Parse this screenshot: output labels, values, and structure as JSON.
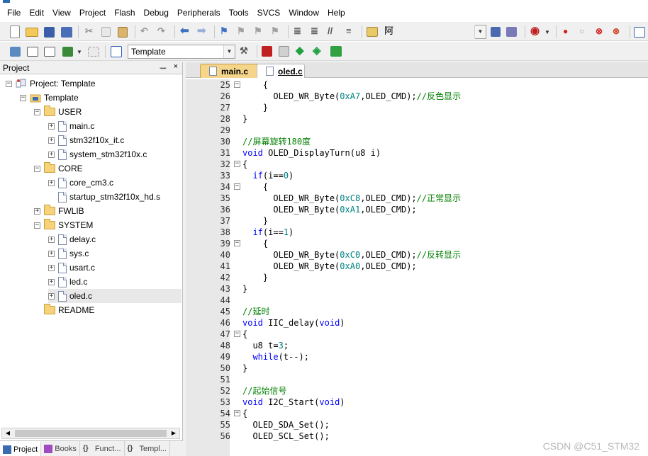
{
  "menu": [
    "File",
    "Edit",
    "View",
    "Project",
    "Flash",
    "Debug",
    "Peripherals",
    "Tools",
    "SVCS",
    "Window",
    "Help"
  ],
  "toolbar1": {
    "combo_value": "",
    "text_glyph": "阿"
  },
  "toolbar2": {
    "target_combo_value": "Template"
  },
  "project_pane": {
    "title": "Project",
    "pin_glyph": "ᅲ",
    "close_glyph": "×",
    "tree": [
      {
        "label": "Project: Template",
        "level": 0,
        "kind": "project",
        "expanded": true
      },
      {
        "label": "Template",
        "level": 1,
        "kind": "target",
        "expanded": true
      },
      {
        "label": "USER",
        "level": 2,
        "kind": "folder",
        "expanded": true
      },
      {
        "label": "main.c",
        "level": 3,
        "kind": "file"
      },
      {
        "label": "stm32f10x_it.c",
        "level": 3,
        "kind": "file"
      },
      {
        "label": "system_stm32f10x.c",
        "level": 3,
        "kind": "file"
      },
      {
        "label": "CORE",
        "level": 2,
        "kind": "folder",
        "expanded": true
      },
      {
        "label": "core_cm3.c",
        "level": 3,
        "kind": "file"
      },
      {
        "label": "startup_stm32f10x_hd.s",
        "level": 3,
        "kind": "file-noexp"
      },
      {
        "label": "FWLIB",
        "level": 2,
        "kind": "folder",
        "expanded": false
      },
      {
        "label": "SYSTEM",
        "level": 2,
        "kind": "folder",
        "expanded": true
      },
      {
        "label": "delay.c",
        "level": 3,
        "kind": "file"
      },
      {
        "label": "sys.c",
        "level": 3,
        "kind": "file"
      },
      {
        "label": "usart.c",
        "level": 3,
        "kind": "file"
      },
      {
        "label": "led.c",
        "level": 3,
        "kind": "file"
      },
      {
        "label": "oled.c",
        "level": 3,
        "kind": "file",
        "selected": true
      },
      {
        "label": "README",
        "level": 2,
        "kind": "folder-noexp"
      }
    ],
    "bottom_tabs": [
      "Project",
      "Books",
      "Funct...",
      "Templ..."
    ]
  },
  "editor": {
    "tabs": [
      "main.c",
      "oled.c"
    ],
    "active_tab": "oled.c",
    "lines": [
      {
        "n": "25",
        "fold": "-",
        "html": "    {"
      },
      {
        "n": "26",
        "fold": "",
        "html": "      OLED_WR_Byte(<span class=\"num\">0xA7</span>,OLED_CMD);<span class=\"cm\">//反色显示</span>"
      },
      {
        "n": "27",
        "fold": "",
        "html": "    }"
      },
      {
        "n": "28",
        "fold": "",
        "html": "}"
      },
      {
        "n": "29",
        "fold": "",
        "html": ""
      },
      {
        "n": "30",
        "fold": "",
        "html": "<span class=\"cm\">//屏幕旋转180度</span>"
      },
      {
        "n": "31",
        "fold": "",
        "html": "<span class=\"kw\">void</span> OLED_DisplayTurn(u8 i)"
      },
      {
        "n": "32",
        "fold": "-",
        "html": "{"
      },
      {
        "n": "33",
        "fold": "",
        "html": "  <span class=\"kw\">if</span>(i==<span class=\"num\">0</span>)"
      },
      {
        "n": "34",
        "fold": "-",
        "html": "    {"
      },
      {
        "n": "35",
        "fold": "",
        "html": "      OLED_WR_Byte(<span class=\"num\">0xC8</span>,OLED_CMD);<span class=\"cm\">//正常显示</span>"
      },
      {
        "n": "36",
        "fold": "",
        "html": "      OLED_WR_Byte(<span class=\"num\">0xA1</span>,OLED_CMD);"
      },
      {
        "n": "37",
        "fold": "",
        "html": "    }"
      },
      {
        "n": "38",
        "fold": "",
        "html": "  <span class=\"kw\">if</span>(i==<span class=\"num\">1</span>)"
      },
      {
        "n": "39",
        "fold": "-",
        "html": "    {"
      },
      {
        "n": "40",
        "fold": "",
        "html": "      OLED_WR_Byte(<span class=\"num\">0xC0</span>,OLED_CMD);<span class=\"cm\">//反转显示</span>"
      },
      {
        "n": "41",
        "fold": "",
        "html": "      OLED_WR_Byte(<span class=\"num\">0xA0</span>,OLED_CMD);"
      },
      {
        "n": "42",
        "fold": "",
        "html": "    }"
      },
      {
        "n": "43",
        "fold": "",
        "html": "}"
      },
      {
        "n": "44",
        "fold": "",
        "html": ""
      },
      {
        "n": "45",
        "fold": "",
        "html": "<span class=\"cm\">//延时</span>"
      },
      {
        "n": "46",
        "fold": "",
        "html": "<span class=\"kw\">void</span> IIC_delay(<span class=\"kw\">void</span>)"
      },
      {
        "n": "47",
        "fold": "-",
        "html": "{"
      },
      {
        "n": "48",
        "fold": "",
        "html": "  u8 t=<span class=\"num\">3</span>;"
      },
      {
        "n": "49",
        "fold": "",
        "html": "  <span class=\"kw\">while</span>(t--);"
      },
      {
        "n": "50",
        "fold": "",
        "html": "}"
      },
      {
        "n": "51",
        "fold": "",
        "html": ""
      },
      {
        "n": "52",
        "fold": "",
        "html": "<span class=\"cm\">//起始信号</span>"
      },
      {
        "n": "53",
        "fold": "",
        "html": "<span class=\"kw\">void</span> I2C_Start(<span class=\"kw\">void</span>)"
      },
      {
        "n": "54",
        "fold": "-",
        "html": "{"
      },
      {
        "n": "55",
        "fold": "",
        "html": "  OLED_SDA_Set();"
      },
      {
        "n": "56",
        "fold": "",
        "html": "  OLED_SCL_Set();"
      }
    ]
  },
  "watermark": "CSDN @C51_STM32",
  "colors": {
    "keyword": "#0000ff",
    "comment": "#008000",
    "number": "#008080",
    "tab_main": "#f5d58a"
  }
}
